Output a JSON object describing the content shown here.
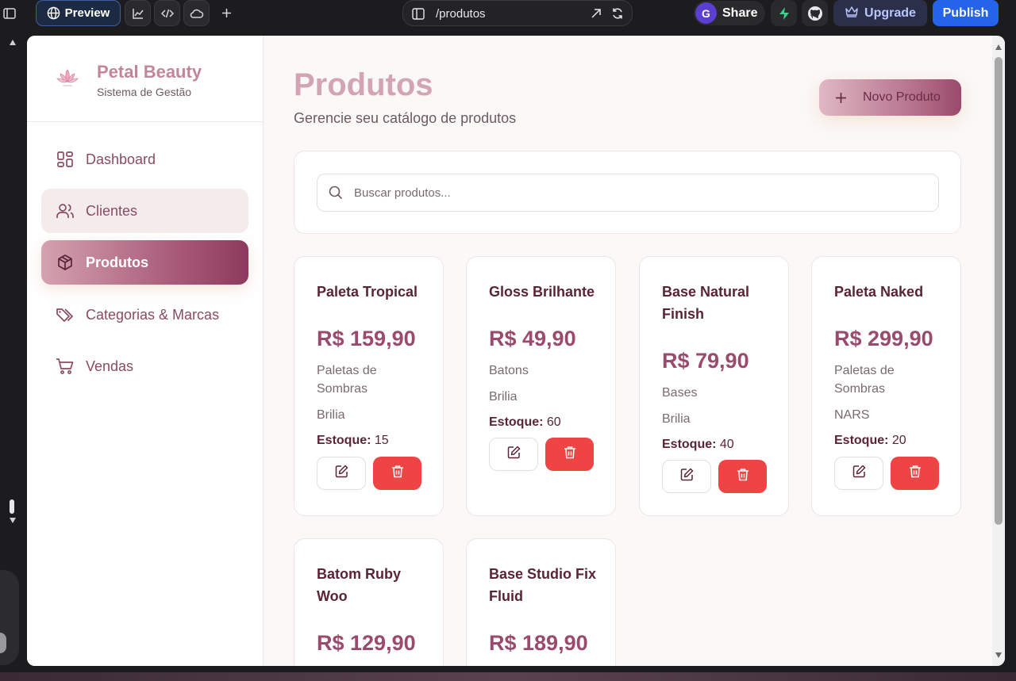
{
  "editor": {
    "preview_label": "Preview",
    "url": "/produtos",
    "avatar_letter": "G",
    "share_label": "Share",
    "upgrade_label": "Upgrade",
    "publish_label": "Publish"
  },
  "brand": {
    "title": "Petal Beauty",
    "subtitle": "Sistema de Gestão"
  },
  "sidebar": {
    "items": [
      {
        "label": "Dashboard",
        "icon": "dashboard-icon"
      },
      {
        "label": "Clientes",
        "icon": "users-icon"
      },
      {
        "label": "Produtos",
        "icon": "box-icon"
      },
      {
        "label": "Categorias & Marcas",
        "icon": "tags-icon"
      },
      {
        "label": "Vendas",
        "icon": "cart-icon"
      }
    ]
  },
  "page": {
    "title": "Produtos",
    "subtitle": "Gerencie seu catálogo de produtos",
    "new_button": "Novo Produto",
    "search_placeholder": "Buscar produtos..."
  },
  "stock_label": "Estoque:",
  "products": [
    {
      "name": "Paleta Tropical",
      "price": "R$ 159,90",
      "category": "Paletas de Sombras",
      "brand": "Brilia",
      "stock": "15"
    },
    {
      "name": "Gloss Brilhante",
      "price": "R$ 49,90",
      "category": "Batons",
      "brand": "Brilia",
      "stock": "60"
    },
    {
      "name": "Base Natural Finish",
      "price": "R$ 79,90",
      "category": "Bases",
      "brand": "Brilia",
      "stock": "40"
    },
    {
      "name": "Paleta Naked",
      "price": "R$ 299,90",
      "category": "Paletas de Sombras",
      "brand": "NARS",
      "stock": "20"
    },
    {
      "name": "Batom Ruby Woo",
      "price": "R$ 129,90"
    },
    {
      "name": "Base Studio Fix Fluid",
      "price": "R$ 189,90"
    }
  ],
  "colors": {
    "accent": "#9a4a6c",
    "title_pink": "#d2a4b4",
    "delete_red": "#ef4444",
    "publish_blue": "#2563eb"
  }
}
